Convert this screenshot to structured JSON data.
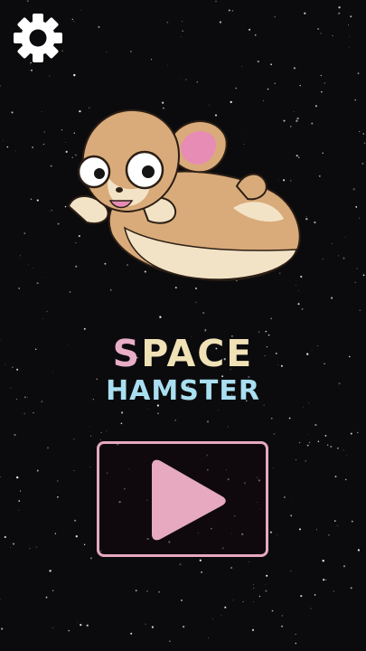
{
  "title": {
    "line1_first": "S",
    "line1_rest": "PACE",
    "line2": "HAMSTER"
  },
  "icons": {
    "settings": "gear-icon",
    "play": "play-icon",
    "mascot": "hamster-illustration"
  },
  "colors": {
    "background": "#0b0b0d",
    "title_line1": "#f0e2b6",
    "title_first_letter": "#e8aec8",
    "title_line2": "#a9dff0",
    "play_accent": "#e6a9bf"
  }
}
